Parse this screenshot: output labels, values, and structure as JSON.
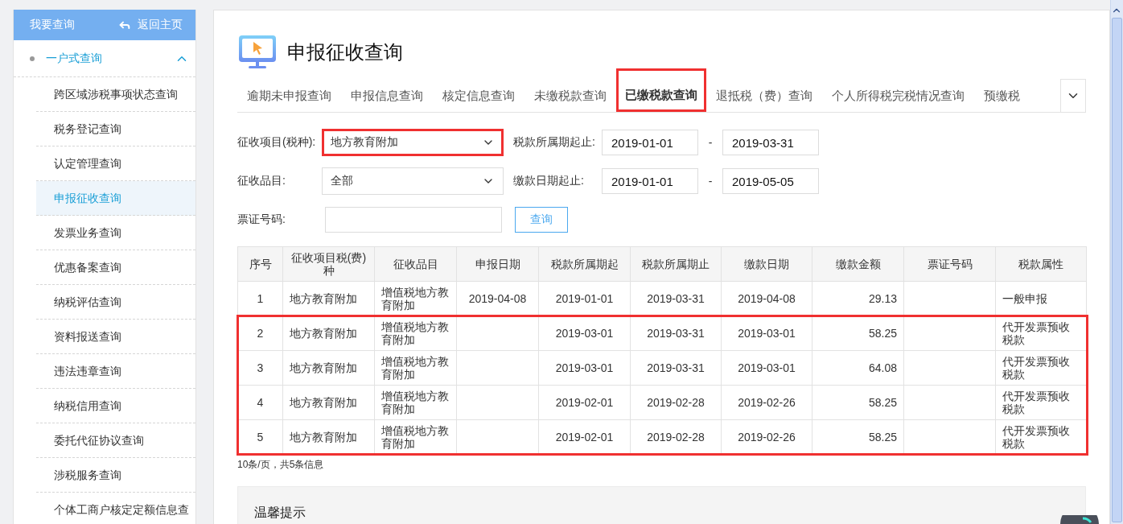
{
  "sidebar": {
    "title": "我要查询",
    "back_link": "返回主页",
    "section": {
      "label": "一户式查询",
      "expanded": true,
      "items": [
        {
          "label": "跨区域涉税事项状态查询",
          "selected": false
        },
        {
          "label": "税务登记查询",
          "selected": false
        },
        {
          "label": "认定管理查询",
          "selected": false
        },
        {
          "label": "申报征收查询",
          "selected": true
        },
        {
          "label": "发票业务查询",
          "selected": false
        },
        {
          "label": "优惠备案查询",
          "selected": false
        },
        {
          "label": "纳税评估查询",
          "selected": false
        },
        {
          "label": "资料报送查询",
          "selected": false
        },
        {
          "label": "违法违章查询",
          "selected": false
        },
        {
          "label": "纳税信用查询",
          "selected": false
        },
        {
          "label": "委托代征协议查询",
          "selected": false
        },
        {
          "label": "涉税服务查询",
          "selected": false
        },
        {
          "label": "个体工商户核定定额信息查",
          "selected": false
        }
      ]
    }
  },
  "page_title": "申报征收查询",
  "tabs": [
    {
      "label": "逾期未申报查询",
      "selected": false
    },
    {
      "label": "申报信息查询",
      "selected": false
    },
    {
      "label": "核定信息查询",
      "selected": false
    },
    {
      "label": "未缴税款查询",
      "selected": false
    },
    {
      "label": "已缴税款查询",
      "selected": true
    },
    {
      "label": "退抵税（费）查询",
      "selected": false
    },
    {
      "label": "个人所得税完税情况查询",
      "selected": false
    },
    {
      "label": "预缴税",
      "selected": false
    }
  ],
  "filter_rows": [
    [
      {
        "kind": "select",
        "label": "征收项目(税种):",
        "value": "地方教育附加",
        "highlighted": true
      },
      {
        "kind": "date_range",
        "label": "税款所属期起止:",
        "from": "2019-01-01",
        "separator": "-",
        "to": "2019-03-31"
      }
    ],
    [
      {
        "kind": "select",
        "label": "征收品目:",
        "value": "全部",
        "highlighted": false
      },
      {
        "kind": "date_range",
        "label": "缴款日期起止:",
        "from": "2019-01-01",
        "separator": "-",
        "to": "2019-05-05"
      }
    ],
    [
      {
        "kind": "text",
        "label": "票证号码:"
      },
      {
        "kind": "button",
        "label": "查询"
      }
    ]
  ],
  "table": {
    "columns": [
      "序号",
      "征收项目税(费)种",
      "征收品目",
      "申报日期",
      "税款所属期起",
      "税款所属期止",
      "缴款日期",
      "缴款金额",
      "票证号码",
      "税款属性"
    ],
    "rows": [
      {
        "highlighted": false,
        "cells": [
          "1",
          "地方教育附加",
          "增值税地方教育附加",
          "2019-04-08",
          "2019-01-01",
          "2019-03-31",
          "2019-04-08",
          "29.13",
          "",
          "一般申报"
        ]
      },
      {
        "highlighted": true,
        "cells": [
          "2",
          "地方教育附加",
          "增值税地方教育附加",
          "",
          "2019-03-01",
          "2019-03-31",
          "2019-03-01",
          "58.25",
          "",
          "代开发票预收税款"
        ]
      },
      {
        "highlighted": true,
        "cells": [
          "3",
          "地方教育附加",
          "增值税地方教育附加",
          "",
          "2019-03-01",
          "2019-03-31",
          "2019-03-01",
          "64.08",
          "",
          "代开发票预收税款"
        ]
      },
      {
        "highlighted": true,
        "cells": [
          "4",
          "地方教育附加",
          "增值税地方教育附加",
          "",
          "2019-02-01",
          "2019-02-28",
          "2019-02-26",
          "58.25",
          "",
          "代开发票预收税款"
        ]
      },
      {
        "highlighted": true,
        "cells": [
          "5",
          "地方教育附加",
          "增值税地方教育附加",
          "",
          "2019-02-01",
          "2019-02-28",
          "2019-02-26",
          "58.25",
          "",
          "代开发票预收税款"
        ]
      }
    ]
  },
  "pagination": "10条/页，共5条信息",
  "tip_title": "温馨提示"
}
